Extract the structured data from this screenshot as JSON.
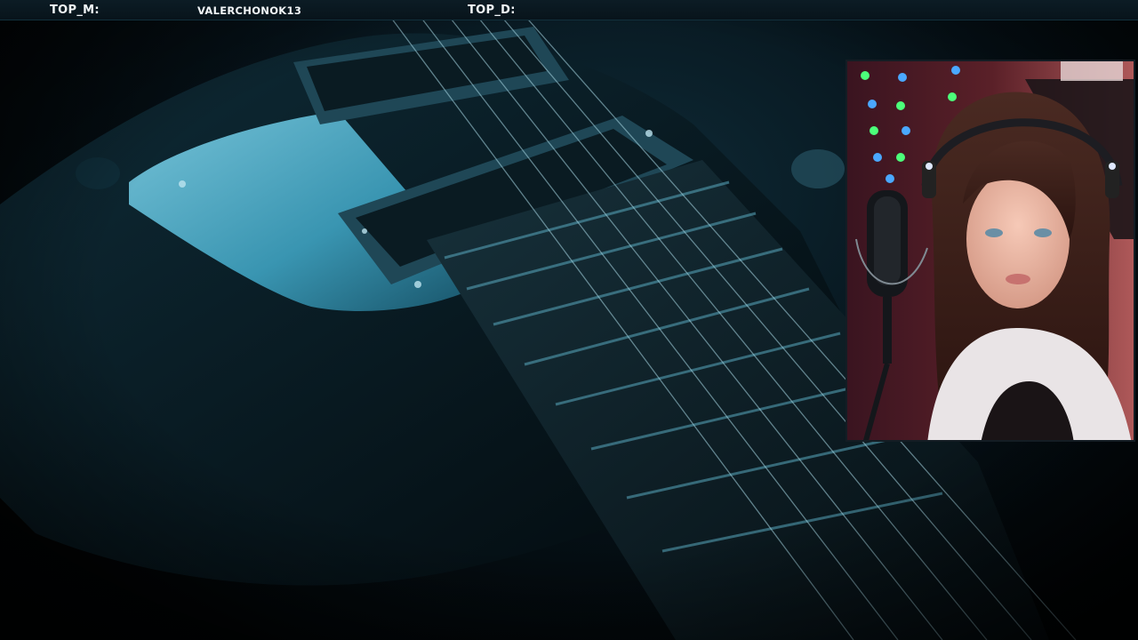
{
  "overlay": {
    "top_m_label": "TOP_M:",
    "top_m_value": "VALERCHONOK13",
    "top_d_label": "TOP_D:",
    "top_d_value": ""
  },
  "scene": {
    "background_subject": "electric-guitar-closeup",
    "accent_color": "#3aa6c6",
    "topbar_color": "#0c1c25"
  },
  "webcam": {
    "subject": "streamer-with-headset-and-microphone"
  }
}
